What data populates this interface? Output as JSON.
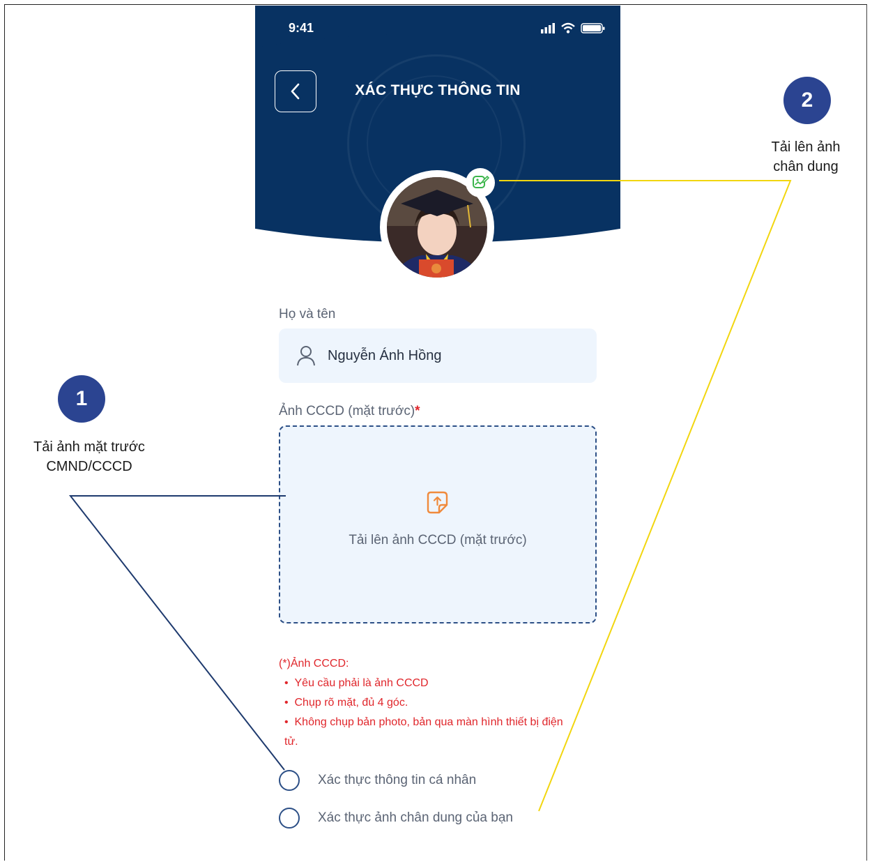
{
  "status_bar": {
    "time": "9:41"
  },
  "header": {
    "title": "XÁC THỰC THÔNG TIN"
  },
  "form": {
    "name_label": "Họ và tên",
    "name_value": "Nguyễn Ánh Hồng",
    "id_front_label": "Ảnh CCCD (mặt trước)",
    "required_mark": "*",
    "upload_text": "Tải lên ảnh CCCD (mặt trước)"
  },
  "notes": {
    "heading": "(*)Ảnh CCCD:",
    "items": [
      "Yêu cầu phải là ảnh CCCD",
      "Chụp rõ mặt, đủ 4 góc.",
      "Không chụp bản photo, bản qua màn hình thiết bị điện tử."
    ]
  },
  "checklist": [
    {
      "label": "Xác thực thông tin cá nhân"
    },
    {
      "label": "Xác thực ảnh chân dung của bạn"
    }
  ],
  "callouts": [
    {
      "number": "1",
      "text_line1": "Tải ảnh mặt trước",
      "text_line2": "CMND/CCCD"
    },
    {
      "number": "2",
      "text_line1": "Tải lên ảnh",
      "text_line2": "chân dung"
    }
  ],
  "colors": {
    "header_bg": "#083262",
    "accent_blue": "#2b4491",
    "warning_red": "#e0262b",
    "upload_orange": "#f08a3c",
    "edit_green": "#3bb54a",
    "callout_line_1": "#1e3a6e",
    "callout_line_2": "#f2d60f"
  }
}
